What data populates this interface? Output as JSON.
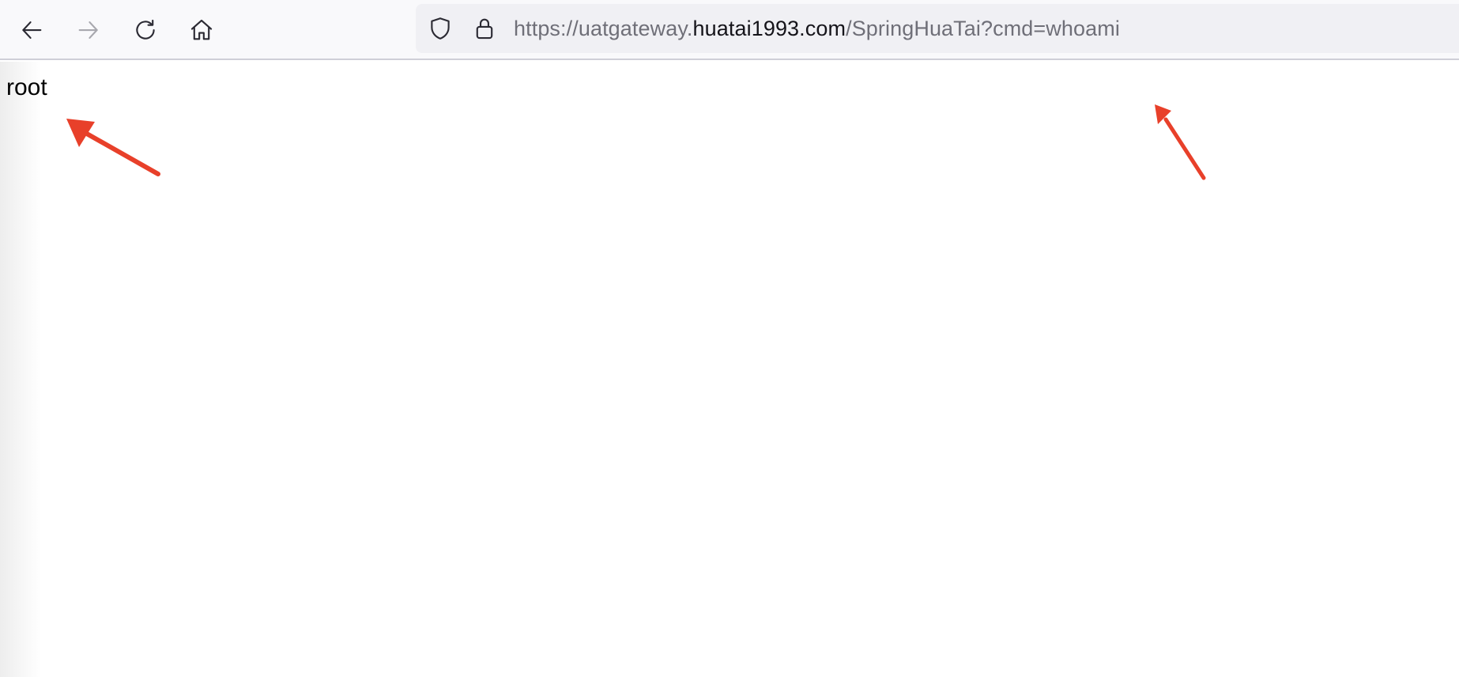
{
  "toolbar": {
    "back_icon": "arrow-left-icon",
    "forward_icon": "arrow-right-icon",
    "reload_icon": "reload-icon",
    "home_icon": "home-icon"
  },
  "urlbar": {
    "protocol_prefix": "https://uatgateway.",
    "host": "huatai1993.com",
    "path": "/SpringHuaTai?cmd=whoami",
    "security_icons": [
      "shield-icon",
      "lock-icon"
    ]
  },
  "page": {
    "output": "root"
  },
  "annotations": {
    "color": "#e8402a",
    "arrows": [
      "annotation-arrow-output",
      "annotation-arrow-url"
    ]
  },
  "colors": {
    "toolbar_bg": "#f9f9fb",
    "urlbar_bg": "#f0f0f4",
    "url_dim": "#6f6f78",
    "url_host": "#15141a"
  }
}
